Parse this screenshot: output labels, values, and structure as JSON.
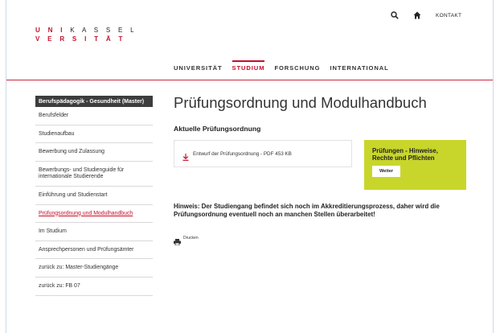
{
  "utility": {
    "search_icon": "search-icon",
    "home_icon": "home-icon",
    "contact_label": "KONTAKT"
  },
  "logo": {
    "line1_red": "U N I",
    "line1_rest": "K A S S E L",
    "line2_red": "V E R S I T",
    "line2_rest": "Ä T"
  },
  "mainnav": {
    "items": [
      {
        "label": "UNIVERSITÄT"
      },
      {
        "label": "STUDIUM"
      },
      {
        "label": "FORSCHUNG"
      },
      {
        "label": "INTERNATIONAL"
      }
    ],
    "active_index": 1
  },
  "sidebar": {
    "header": "Berufspädagogik - Gesundheit (Master)",
    "items": [
      {
        "label": "Berufsfelder"
      },
      {
        "label": "Studienaufbau"
      },
      {
        "label": "Bewerbung und Zulassung"
      },
      {
        "label": "Bewerbungs- und Studienguide für internationale Studierende"
      },
      {
        "label": "Einführung und Studienstart"
      },
      {
        "label": "Prüfungsordnung und Modulhandbuch"
      },
      {
        "label": "Im Studium"
      },
      {
        "label": "Ansprechpersonen und Prüfungsämter"
      },
      {
        "label": "zurück zu: Master-Studiengänge"
      },
      {
        "label": "zurück zu: FB 07"
      }
    ],
    "active_index": 5
  },
  "main": {
    "title": "Prüfungsordnung und Modulhandbuch",
    "subtitle": "Aktuelle Prüfungsordnung",
    "download": {
      "icon": "download-icon",
      "label": "Entwurf der Prüfungsordnung - PDF 453 KB"
    },
    "promo": {
      "title": "Prüfungen - Hinweise, Rechte und Pflichten",
      "button": "Weiter",
      "color": "#c8d62b"
    },
    "notice": "Hinweis: Der Studiengang befindet sich noch im Akkreditierungsprozess, daher wird die Prüfungsordnung eventuell noch an manchen Stellen überarbeitet!",
    "print": {
      "icon": "print-icon",
      "label": "Drucken"
    }
  },
  "colors": {
    "accent": "#c4102a",
    "sidebar_header_bg": "#3d3d3d"
  }
}
